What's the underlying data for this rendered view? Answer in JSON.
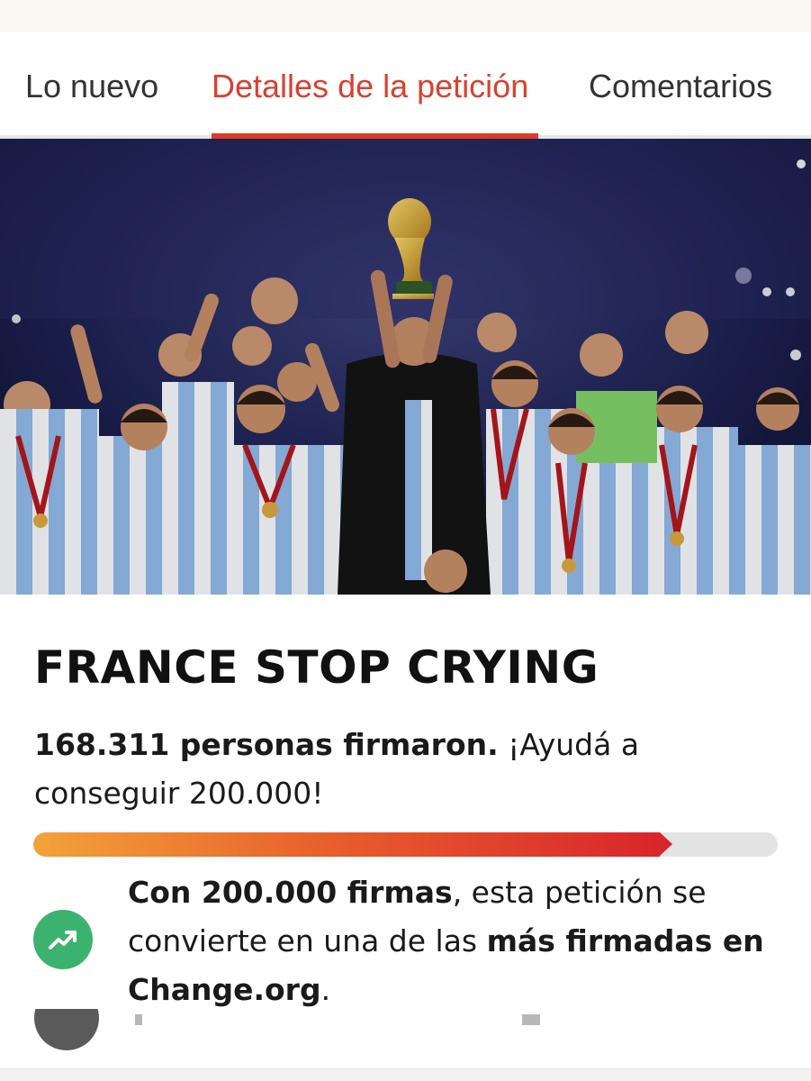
{
  "tabs": [
    {
      "label": "Lo nuevo",
      "active": false
    },
    {
      "label": "Detalles de la petición",
      "active": true
    },
    {
      "label": "Comentarios",
      "active": false
    }
  ],
  "petition": {
    "title": "FRANCE STOP CRYING",
    "signed_count_text": "168.311 personas firmaron.",
    "goal_text": " ¡Ayudá a conseguir 200.000!",
    "progress_fraction": 0.858
  },
  "milestone": {
    "icon": "trending-up-icon",
    "part1_bold": "Con 200.000 firmas",
    "part2": ", esta petición se convierte en una de las ",
    "part3_bold": "más firmadas en Change.org",
    "part4": "."
  },
  "colors": {
    "accent": "#e03a26",
    "active_tab_text": "#d9412f",
    "milestone_icon_bg": "#3bb36e",
    "progress_start": "#f2a33a",
    "progress_end": "#d8262b"
  }
}
